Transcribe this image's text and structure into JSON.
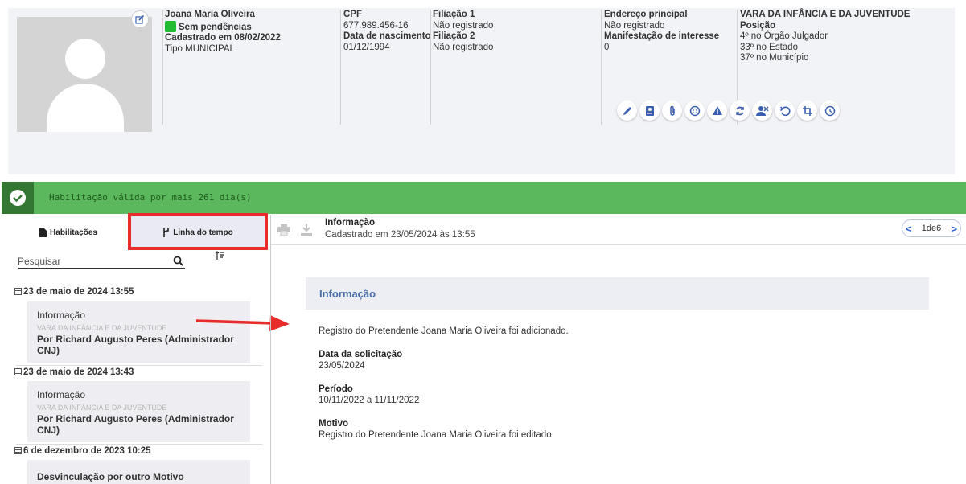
{
  "header": {
    "name": "Joana Maria Oliveira",
    "status": "Sem pendências",
    "registered": "Cadastrado em 08/02/2022",
    "type": "Tipo MUNICIPAL",
    "cpf_label": "CPF",
    "cpf": "677.989.456-16",
    "birth_label": "Data de nascimento",
    "birth": "01/12/1994",
    "filiacao1_label": "Filiação 1",
    "filiacao1": "Não registrado",
    "filiacao2_label": "Filiação 2",
    "filiacao2": "Não registrado",
    "address_label": "Endereço principal",
    "address": "Não registrado",
    "interest_label": "Manifestação de interesse",
    "interest": "0",
    "court": "VARA DA INFÂNCIA E DA JUVENTUDE",
    "position_label": "Posição",
    "pos_court": "4º no Órgão Julgador",
    "pos_state": "33º no Estado",
    "pos_city": "37º no Município",
    "actions": [
      "pencil-icon",
      "id-card-icon",
      "paperclip-icon",
      "face-icon",
      "warning-icon",
      "sync-icon",
      "user-remove-icon",
      "undo-icon",
      "crop-icon",
      "history-icon"
    ]
  },
  "status_bar": {
    "text": "Habilitação válida por mais 261 dia(s)",
    "color": "#5cb85c"
  },
  "left": {
    "tab_habilitacoes": "Habilitações",
    "tab_timeline": "Linha do tempo",
    "search_placeholder": "Pesquisar",
    "groups": [
      {
        "date": "23 de maio de 2024 13:55",
        "title": "Informação",
        "court": "VARA DA INFÂNCIA E DA JUVENTUDE",
        "author": "Por Richard Augusto Peres (Administrador CNJ)"
      },
      {
        "date": "23 de maio de 2024 13:43",
        "title": "Informação",
        "court": "VARA DA INFÂNCIA E DA JUVENTUDE",
        "author": "Por Richard Augusto Peres (Administrador CNJ)"
      },
      {
        "date": "6 de dezembro de 2023 10:25",
        "title": "Desvinculação por outro Motivo"
      }
    ]
  },
  "right": {
    "title": "Informação",
    "subtitle": "Cadastrado em 23/05/2024 às 13:55",
    "pager": "1de6",
    "detail_title": "Informação",
    "message": "Registro do Pretendente Joana Maria Oliveira foi adicionado.",
    "date_label": "Data da solicitação",
    "date": "23/05/2024",
    "period_label": "Período",
    "period": "10/11/2022 a 11/11/2022",
    "reason_label": "Motivo",
    "reason": "Registro do Pretendente Joana Maria Oliveira foi editado"
  }
}
